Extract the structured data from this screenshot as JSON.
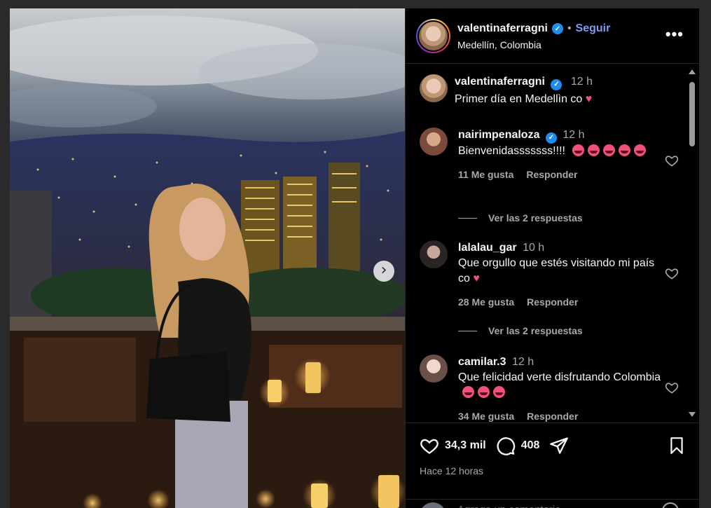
{
  "post": {
    "username": "valentinaferragni",
    "follow_label": "Seguir",
    "location": "Medellín, Colombia",
    "more_label": "•••",
    "caption": "Primer día en Medellìn co",
    "caption_time": "12 h"
  },
  "comments": [
    {
      "user": "nairimpenaloza",
      "verified": true,
      "time": "12 h",
      "text": "Bienvenidasssssss!!!!",
      "likes": "11 Me gusta",
      "reply": "Responder",
      "view_replies": "Ver las 2 respuestas",
      "avatar_color": "#7a4a3a"
    },
    {
      "user": "lalalau_gar",
      "verified": false,
      "time": "10 h",
      "text": "Que orgullo que estés visitando mi país co",
      "likes": "28 Me gusta",
      "reply": "Responder",
      "view_replies": "Ver las 2 respuestas",
      "avatar_color": "#3a3030"
    },
    {
      "user": "camilar.3",
      "verified": false,
      "time": "12 h",
      "text": "Que felicidad verte disfrutando Colombia",
      "likes": "34 Me gusta",
      "reply": "Responder",
      "avatar_color": "#c9b4a8"
    }
  ],
  "actions": {
    "likes": "34,3 mil",
    "comments": "408",
    "time_ago": "Hace 12 horas",
    "add_comment_placeholder": "Agrega un comentario..."
  },
  "colors": {
    "verified": "#1f8cf0",
    "follow": "#7b9cf5",
    "emoji": "#f0507a"
  }
}
